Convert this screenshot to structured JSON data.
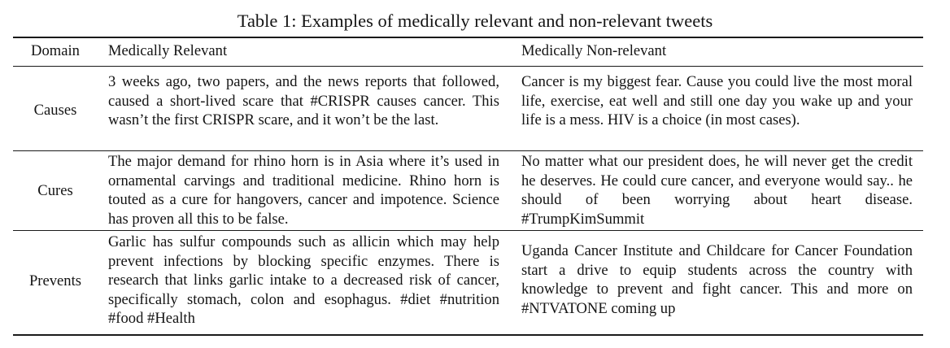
{
  "caption": "Table 1: Examples of medically relevant and non-relevant tweets",
  "table": {
    "headers": {
      "domain": "Domain",
      "relevant": "Medically Relevant",
      "nonrelevant": "Medically Non-relevant"
    },
    "rows": [
      {
        "domain": "Causes",
        "relevant": "3 weeks ago, two papers, and the news reports that followed, caused a short-lived scare that #CRISPR causes cancer. This wasn’t the first CRISPR scare, and it won’t be the last.",
        "nonrelevant": "Cancer is my biggest fear. Cause you could live the most moral life, exercise, eat well and still one day you wake up and your life is a mess. HIV is a choice (in most cases)."
      },
      {
        "domain": "Cures",
        "relevant": "The major demand for rhino horn is in Asia where it’s used in ornamental carvings and traditional medicine. Rhino horn is touted as a cure for hangovers, cancer and impotence. Science has proven all this to be false.",
        "nonrelevant": "No matter what our president does, he will never get the credit he deserves. He could cure cancer, and ev­eryone would say.. he should of been worrying about heart disease. #TrumpKimSummit"
      },
      {
        "domain": "Prevents",
        "relevant": "Garlic has sulfur compounds such as allicin which may help prevent infections by blocking specific en­zymes. There is research that links garlic intake to a decreased risk of cancer, specifically stomach, colon and esophagus. #diet #nutrition #food #Health",
        "nonrelevant": "Uganda Cancer Institute and Childcare for Cancer Foundation start a drive to equip students across the country with knowledge to prevent and fight cancer. This and more on #NTVATONE coming up"
      }
    ]
  }
}
